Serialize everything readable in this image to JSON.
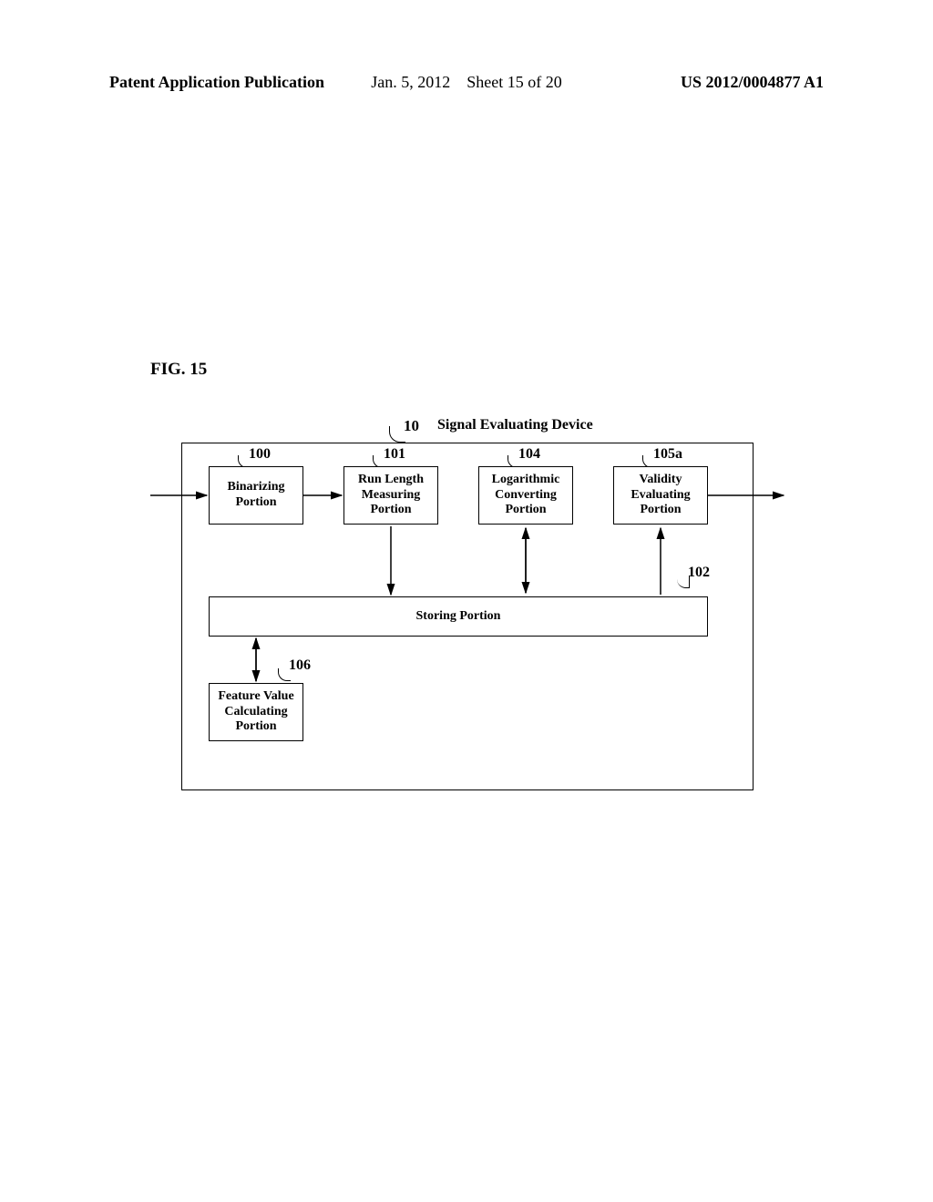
{
  "header": {
    "left": "Patent Application Publication",
    "center_date": "Jan. 5, 2012",
    "center_sheet": "Sheet 15 of 20",
    "right": "US 2012/0004877 A1"
  },
  "figure_label": "FIG. 15",
  "device": {
    "ref": "10",
    "label": "Signal Evaluating Device"
  },
  "refs": {
    "b100": "100",
    "b101": "101",
    "b104": "104",
    "b105": "105a",
    "b102": "102",
    "b106": "106"
  },
  "blocks": {
    "b100_l1": "Binarizing",
    "b100_l2": "Portion",
    "b101_l1": "Run Length",
    "b101_l2": "Measuring",
    "b101_l3": "Portion",
    "b104_l1": "Logarithmic",
    "b104_l2": "Converting",
    "b104_l3": "Portion",
    "b105_l1": "Validity",
    "b105_l2": "Evaluating",
    "b105_l3": "Portion",
    "b102": "Storing Portion",
    "b106_l1": "Feature Value",
    "b106_l2": "Calculating",
    "b106_l3": "Portion"
  }
}
